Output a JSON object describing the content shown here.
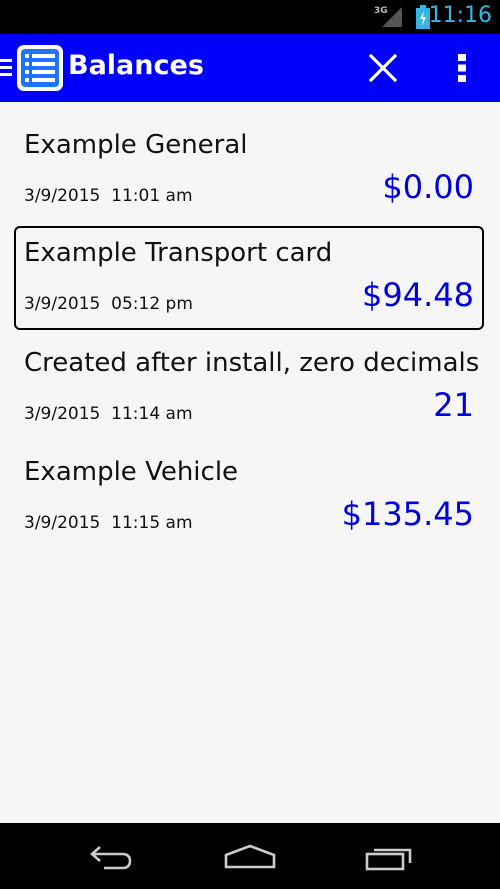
{
  "status_bar": {
    "network": "3G",
    "time": "11:16"
  },
  "action_bar": {
    "title": "Balances",
    "icons": {
      "up": "menu-up-icon",
      "app": "balance-list-icon",
      "close": "close-icon",
      "overflow": "more-vert-icon"
    },
    "color": "#0000ff"
  },
  "balances": [
    {
      "name": "Example General",
      "date": "3/9/2015  11:01 am",
      "amount": "$0.00",
      "selected": false
    },
    {
      "name": "Example Transport card",
      "date": "3/9/2015  05:12 pm",
      "amount": "$94.48",
      "selected": true
    },
    {
      "name": "Created after install, zero decimals",
      "date": "3/9/2015  11:14 am",
      "amount": "21",
      "selected": false
    },
    {
      "name": "Example Vehicle",
      "date": "3/9/2015  11:15 am",
      "amount": "$135.45",
      "selected": false
    }
  ],
  "nav_bar": {
    "icons": [
      "back-icon",
      "home-icon",
      "recents-icon"
    ]
  },
  "colors": {
    "accent": "#0000ff",
    "amount": "#0000dd",
    "status_text": "#33b5e5"
  }
}
